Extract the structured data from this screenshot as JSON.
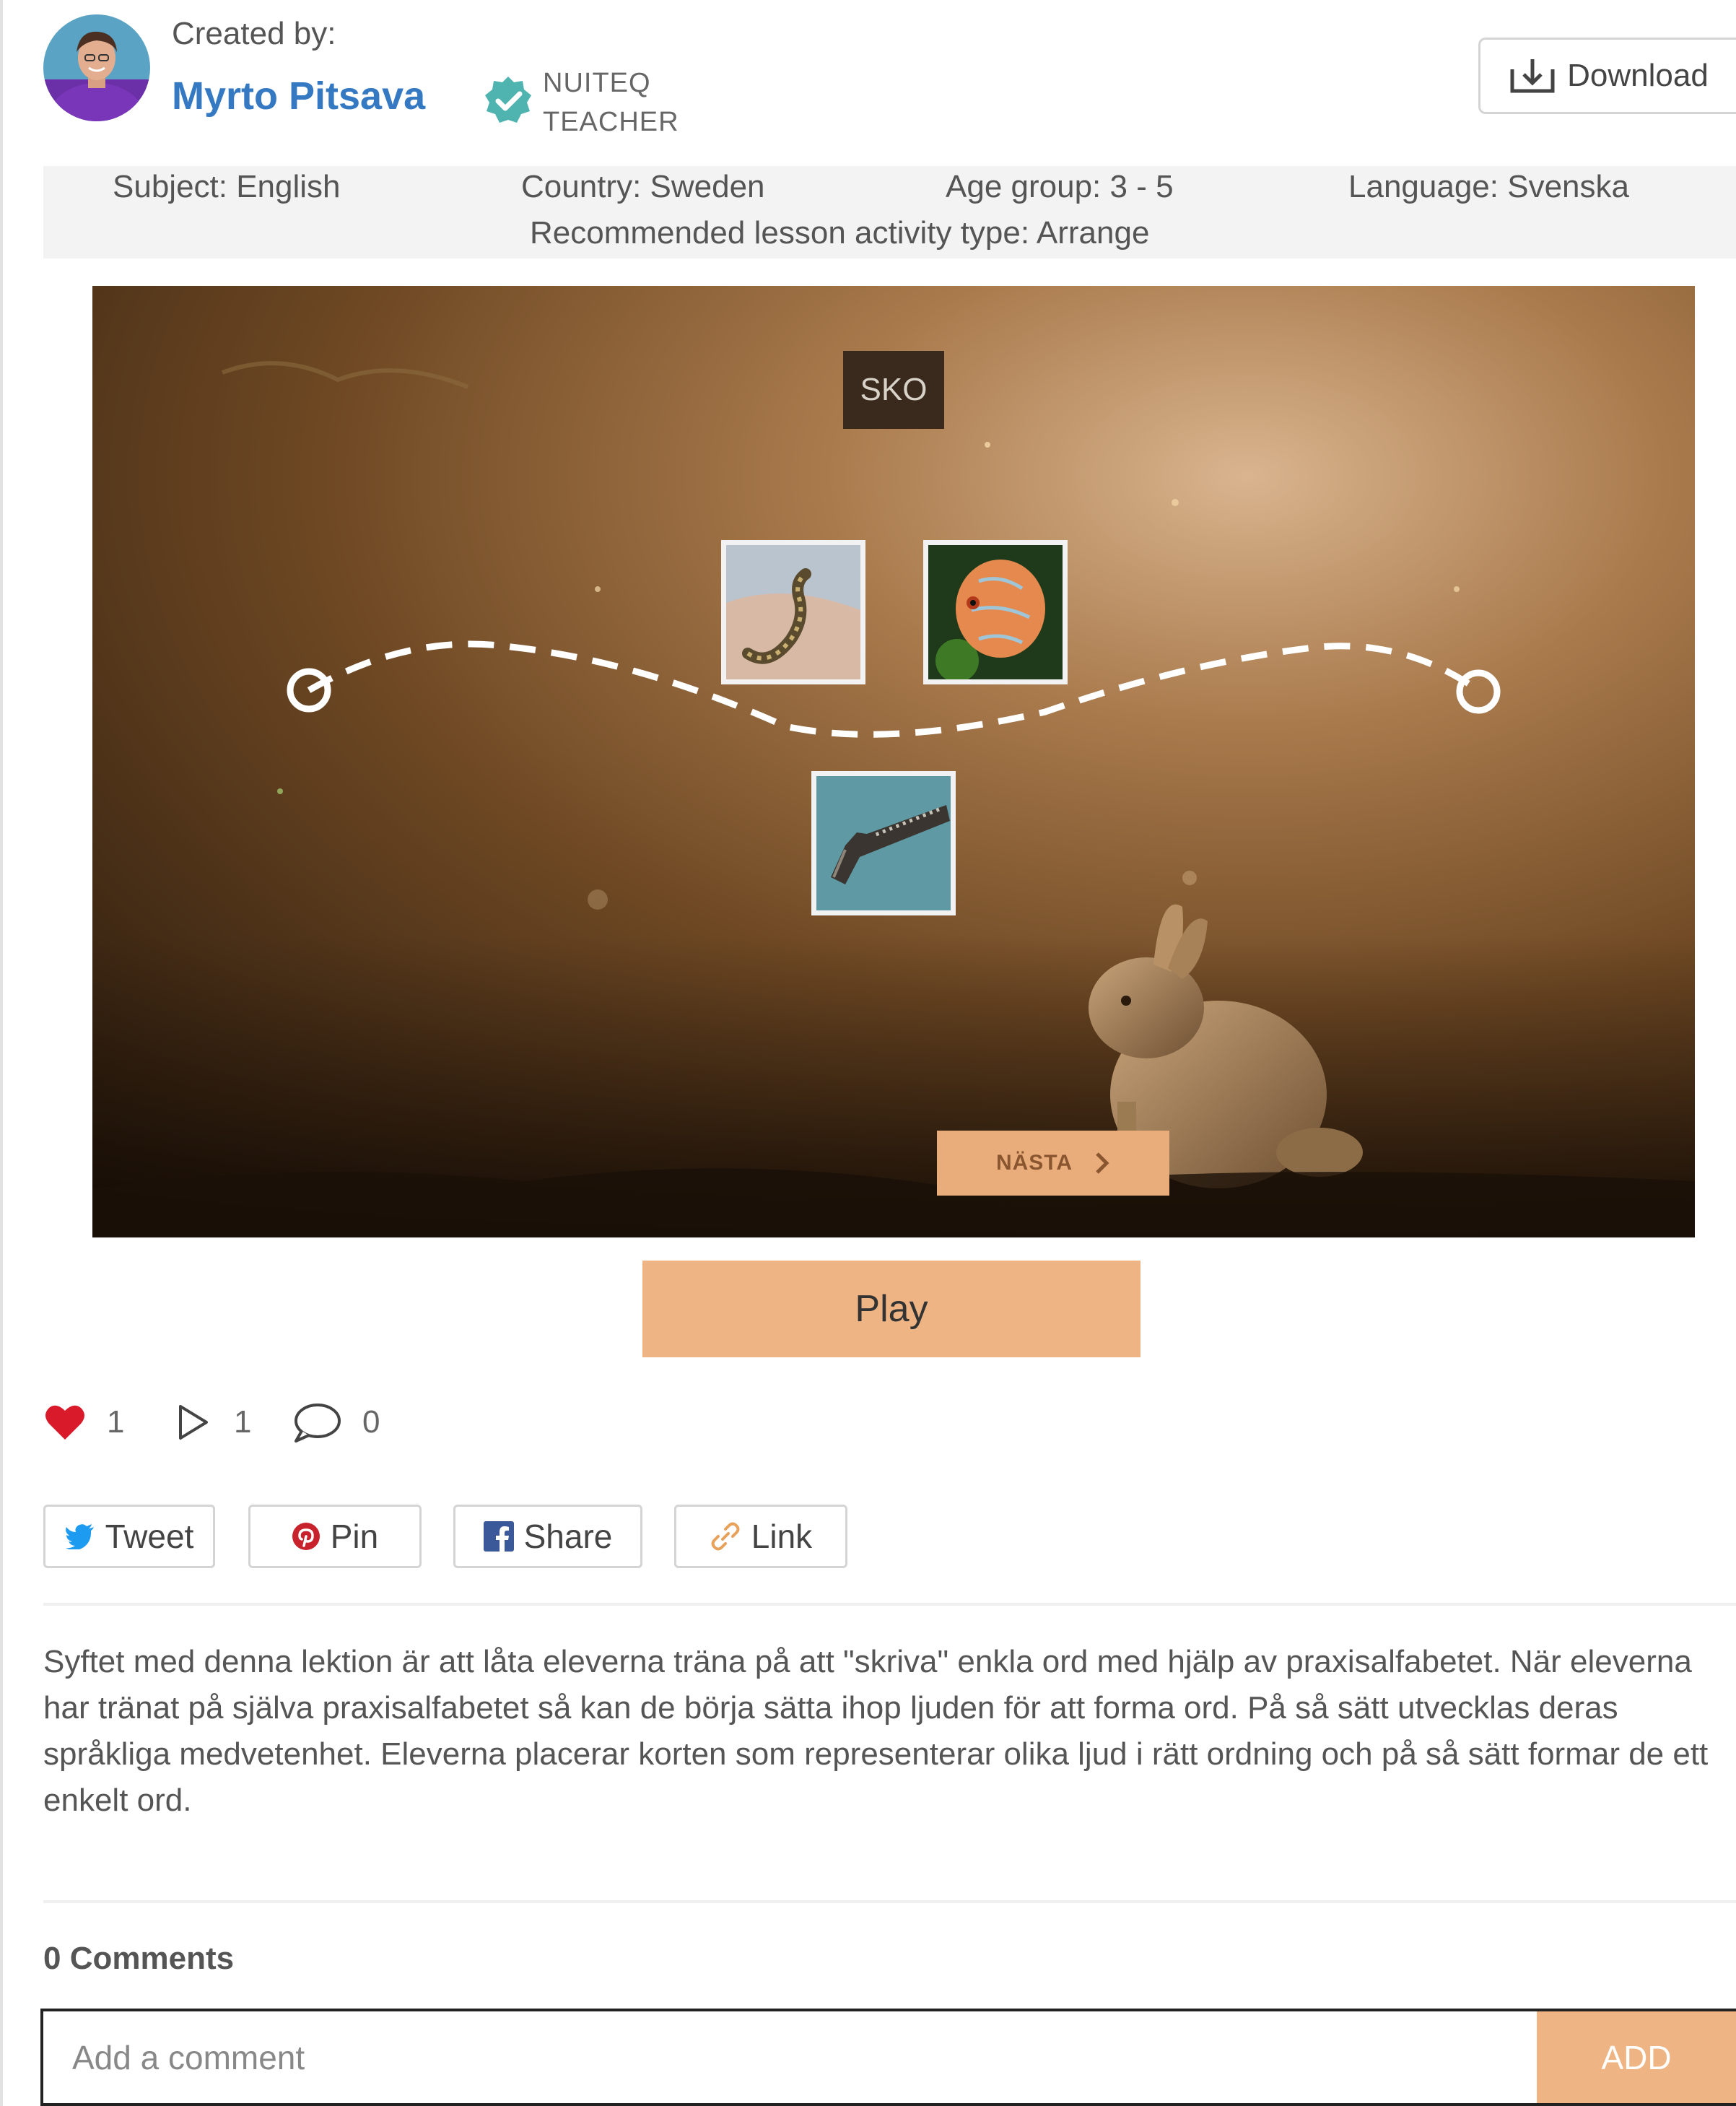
{
  "header": {
    "created_by_label": "Created by:",
    "author_name": "Myrto Pitsava",
    "badge_line1": "NUITEQ",
    "badge_line2": "TEACHER",
    "download_label": "Download"
  },
  "info": {
    "subject": "Subject: English",
    "country": "Country: Sweden",
    "age_group": "Age group: 3 - 5",
    "language": "Language: Svenska",
    "activity_type": "Recommended lesson activity type: Arrange"
  },
  "preview": {
    "word": "SKO",
    "next_label": "NÄSTA",
    "cards": [
      "snake",
      "fish",
      "pistol"
    ]
  },
  "play_label": "Play",
  "stats": {
    "likes": "1",
    "plays": "1",
    "comments": "0"
  },
  "share": {
    "tweet": "Tweet",
    "pin": "Pin",
    "share": "Share",
    "link": "Link"
  },
  "description": "Syftet med denna lektion är att låta eleverna träna på att \"skriva\" enkla ord med hjälp av praxisalfabetet. När eleverna har tränat på själva praxisalfabetet så kan de börja sätta ihop ljuden för att forma ord. På så sätt utvecklas deras språkliga medvetenhet. Eleverna placerar korten som representerar olika ljud i rätt ordning och på så sätt formar de ett enkelt ord.",
  "comments": {
    "title": "0 Comments",
    "placeholder": "Add a comment",
    "add_label": "ADD"
  },
  "colors": {
    "author": "#3579c2",
    "accent": "#efb484",
    "badge": "#4fb3b0",
    "heart": "#d91a2a"
  }
}
